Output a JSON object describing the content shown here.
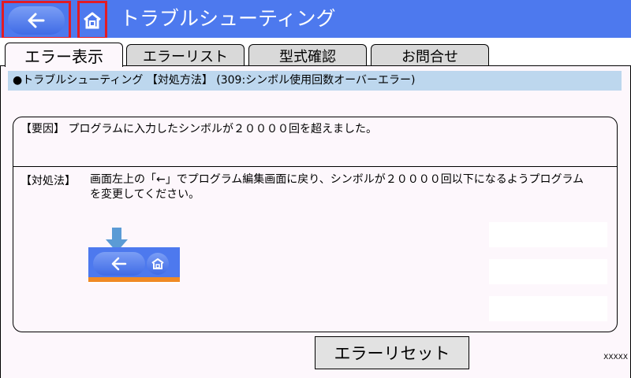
{
  "header": {
    "title": "トラブルシューティング",
    "back_icon": "arrow-left-icon",
    "home_icon": "home-icon",
    "color": "#4d79ee"
  },
  "tabs": [
    {
      "label": "エラー表示",
      "active": true
    },
    {
      "label": "エラーリスト",
      "active": false
    },
    {
      "label": "型式確認",
      "active": false
    },
    {
      "label": "お問合せ",
      "active": false
    }
  ],
  "content": {
    "heading": "●トラブルシューティング 【対処方法】 (309:シンボル使用回数オーバーエラー)",
    "cause": "【要因】 プログラムに入力したシンボルが２００００回を超えました。",
    "remedy_label": "【対処法】",
    "remedy_text": "画面左上の「←」でプログラム編集画面に戻り、シンボルが２００００回以下になるようプログラムを変更してください。"
  },
  "footer": {
    "reset_label": "エラーリセット",
    "code": "XXXXX"
  },
  "colors": {
    "highlight": "#e21b25",
    "heading_bg": "#bdd7ee",
    "panel_bg": "#fdf7fc",
    "thumb_bar": "#f08a24",
    "pointer": "#5b9bd5"
  }
}
